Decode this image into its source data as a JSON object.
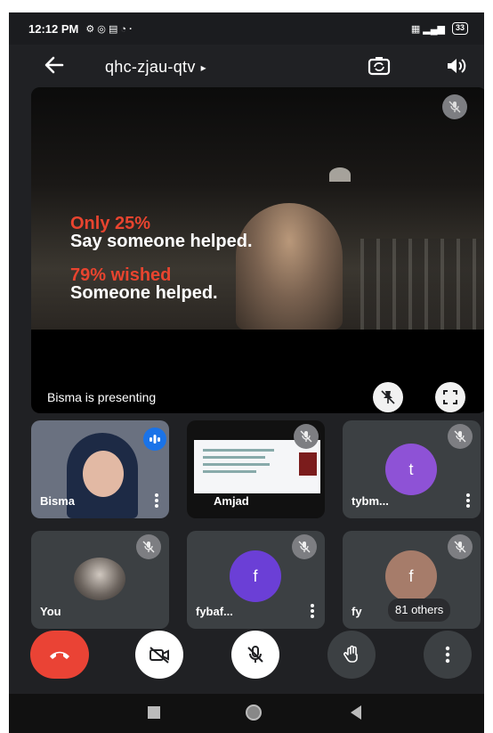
{
  "status_bar": {
    "time": "12:12 PM",
    "battery": "33"
  },
  "top_bar": {
    "meeting_code": "qhc-zjau-qtv",
    "caret": "▸"
  },
  "presentation": {
    "slide_lines": [
      "Only 25%",
      "Say someone helped.",
      "79% wished",
      "Someone helped."
    ],
    "presenting_text": "Bisma is presenting"
  },
  "tiles": [
    {
      "name": "Bisma",
      "type": "video"
    },
    {
      "name": "Amjad",
      "type": "screen"
    },
    {
      "name": "tybm...",
      "type": "avatar",
      "initial": "t",
      "avatar_color": "#8e52d6"
    },
    {
      "name": "You",
      "type": "photo"
    },
    {
      "name": "fybaf...",
      "type": "avatar",
      "initial": "f",
      "avatar_color": "#6b3fd6"
    },
    {
      "name": "fy",
      "type": "avatar",
      "initial": "f",
      "avatar_color": "#a67c6a"
    }
  ],
  "others_label": "81 others",
  "colors": {
    "end_call": "#ea4335",
    "background": "#202124",
    "tile": "#3c4043"
  }
}
